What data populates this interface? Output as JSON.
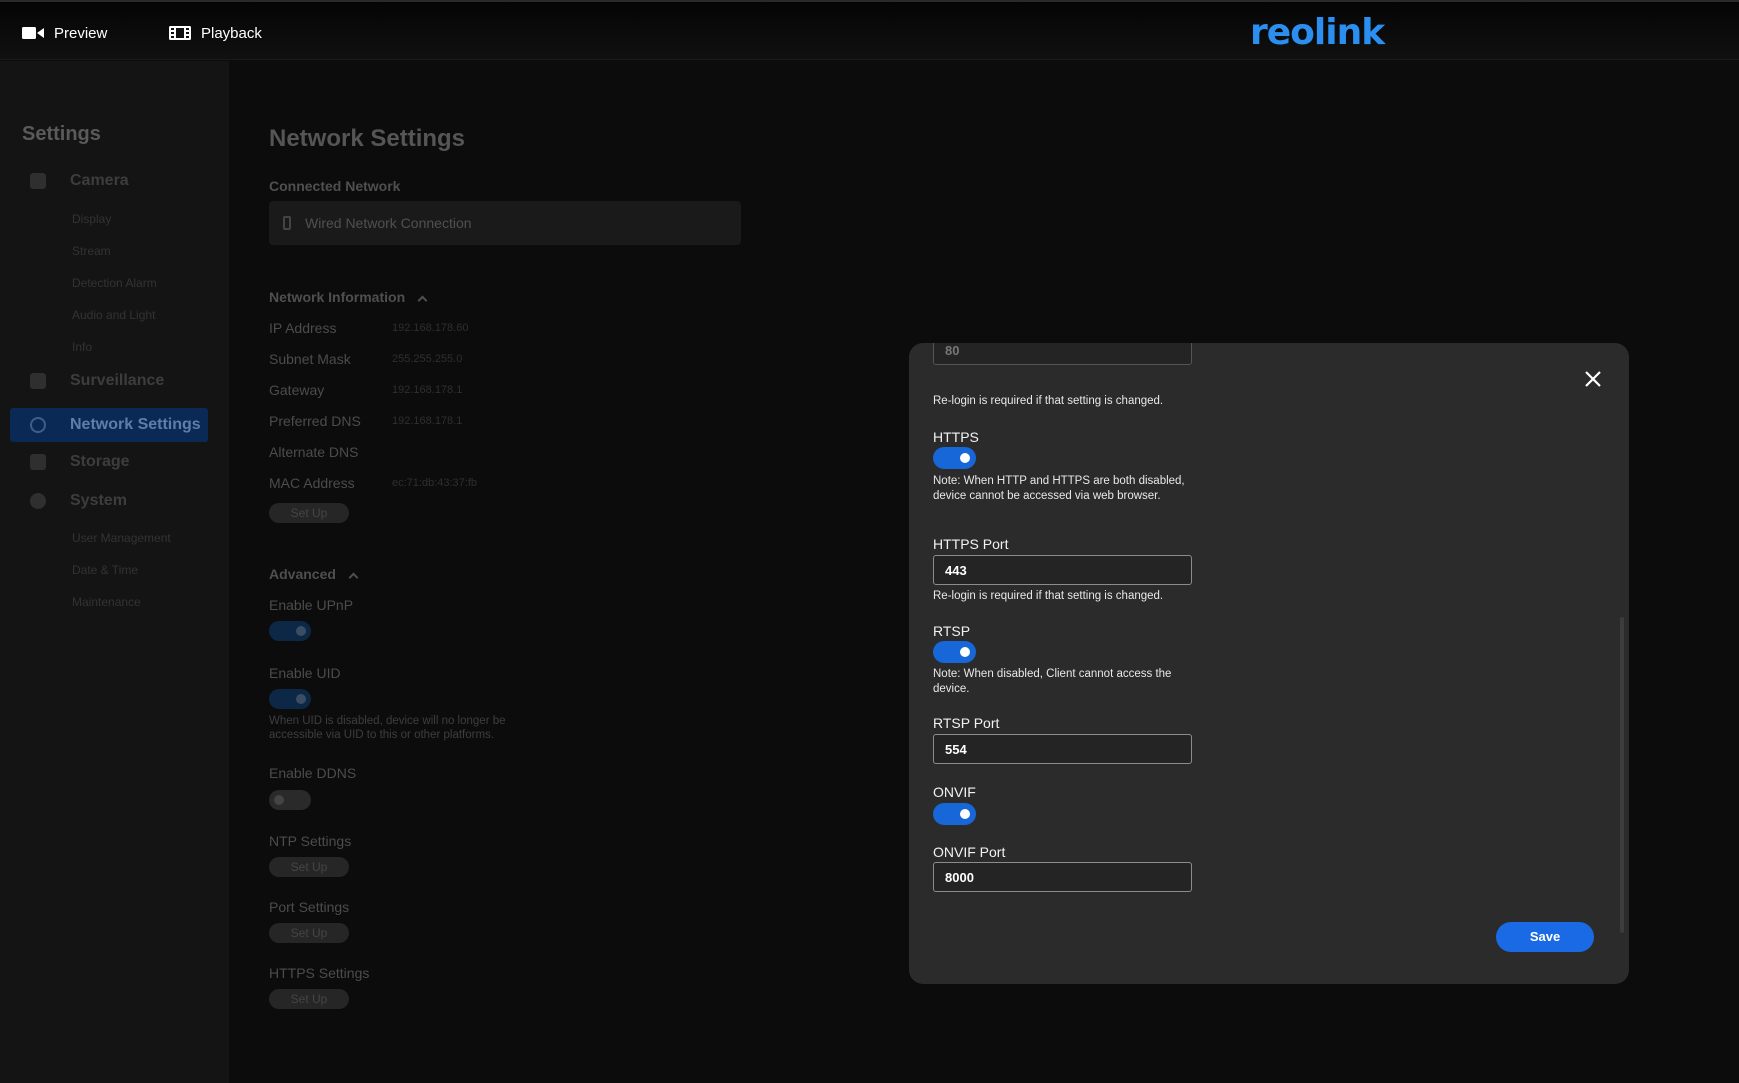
{
  "topbar": {
    "preview_label": "Preview",
    "playback_label": "Playback",
    "logo_text": "reolink"
  },
  "sidebar": {
    "title": "Settings",
    "groups": [
      {
        "label": "Camera",
        "subitems": [
          "Display",
          "Stream",
          "Detection Alarm",
          "Audio and Light",
          "Info"
        ]
      },
      {
        "label": "Surveillance",
        "subitems": []
      },
      {
        "label": "Network Settings",
        "subitems": [],
        "active": true
      },
      {
        "label": "Storage",
        "subitems": []
      },
      {
        "label": "System",
        "subitems": [
          "User Management",
          "Date & Time",
          "Maintenance"
        ]
      }
    ]
  },
  "main": {
    "title": "Network Settings",
    "connected_network_label": "Connected Network",
    "connection_name": "Wired Network Connection",
    "network_info_label": "Network Information",
    "info_rows": [
      {
        "label": "IP Address",
        "value": "192.168.178.60"
      },
      {
        "label": "Subnet Mask",
        "value": "255.255.255.0"
      },
      {
        "label": "Gateway",
        "value": "192.168.178.1"
      },
      {
        "label": "Preferred DNS",
        "value": "192.168.178.1"
      },
      {
        "label": "Alternate DNS",
        "value": ""
      },
      {
        "label": "MAC Address",
        "value": "ec:71:db:43:37:fb"
      }
    ],
    "setup_label": "Set Up",
    "advanced_label": "Advanced",
    "enable_upnp_label": "Enable UPnP",
    "enable_uid_label": "Enable UID",
    "uid_note": "When UID is disabled, device will no longer be accessible via UID to this or other platforms.",
    "enable_ddns_label": "Enable DDNS",
    "ntp_label": "NTP Settings",
    "port_label": "Port Settings",
    "https_settings_label": "HTTPS Settings"
  },
  "modal": {
    "http_port_value": "80",
    "relogin_note": "Re-login is required if that setting is changed.",
    "https_label": "HTTPS",
    "https_enabled": true,
    "https_note": "Note: When HTTP and HTTPS are both disabled, device cannot be accessed via web browser.",
    "https_port_label": "HTTPS Port",
    "https_port_value": "443",
    "rtsp_label": "RTSP",
    "rtsp_enabled": true,
    "rtsp_note": "Note: When disabled, Client cannot access the device.",
    "rtsp_port_label": "RTSP Port",
    "rtsp_port_value": "554",
    "onvif_label": "ONVIF",
    "onvif_enabled": true,
    "onvif_port_label": "ONVIF Port",
    "onvif_port_value": "8000",
    "save_label": "Save"
  },
  "colors": {
    "accent": "#1a6ae6",
    "logo": "#2a8ff0",
    "modal_bg": "#2b2b2b",
    "page_bg": "#0c0c0c"
  }
}
